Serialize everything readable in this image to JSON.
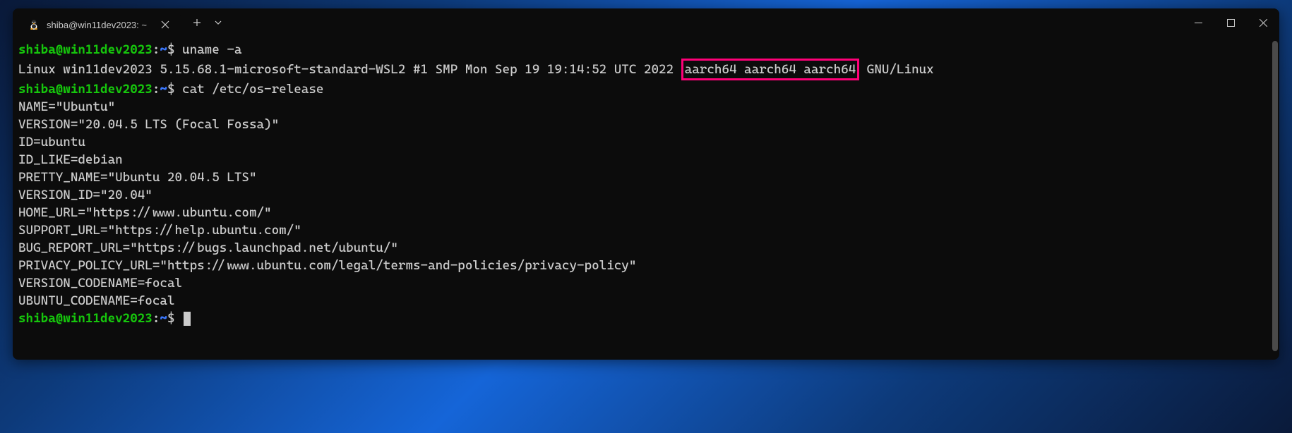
{
  "window": {
    "tab_title": "shiba@win11dev2023: ~"
  },
  "terminal": {
    "prompt_user": "shiba@win11dev2023",
    "prompt_path": "~",
    "lines": [
      {
        "type": "prompt",
        "cmd": "uname -a"
      },
      {
        "type": "output_highlight",
        "pre": "Linux win11dev2023 5.15.68.1-microsoft-standard-WSL2 #1 SMP Mon Sep 19 19:14:52 UTC 2022 ",
        "highlight": "aarch64 aarch64 aarch64",
        "post": " GNU/Linux"
      },
      {
        "type": "prompt",
        "cmd": "cat /etc/os-release"
      },
      {
        "type": "output",
        "text": "NAME=\"Ubuntu\""
      },
      {
        "type": "output",
        "text": "VERSION=\"20.04.5 LTS (Focal Fossa)\""
      },
      {
        "type": "output",
        "text": "ID=ubuntu"
      },
      {
        "type": "output",
        "text": "ID_LIKE=debian"
      },
      {
        "type": "output",
        "text": "PRETTY_NAME=\"Ubuntu 20.04.5 LTS\""
      },
      {
        "type": "output",
        "text": "VERSION_ID=\"20.04\""
      },
      {
        "type": "output",
        "text": "HOME_URL=\"https://www.ubuntu.com/\""
      },
      {
        "type": "output",
        "text": "SUPPORT_URL=\"https://help.ubuntu.com/\""
      },
      {
        "type": "output",
        "text": "BUG_REPORT_URL=\"https://bugs.launchpad.net/ubuntu/\""
      },
      {
        "type": "output",
        "text": "PRIVACY_POLICY_URL=\"https://www.ubuntu.com/legal/terms-and-policies/privacy-policy\""
      },
      {
        "type": "output",
        "text": "VERSION_CODENAME=focal"
      },
      {
        "type": "output",
        "text": "UBUNTU_CODENAME=focal"
      },
      {
        "type": "prompt_cursor",
        "cmd": ""
      }
    ]
  }
}
